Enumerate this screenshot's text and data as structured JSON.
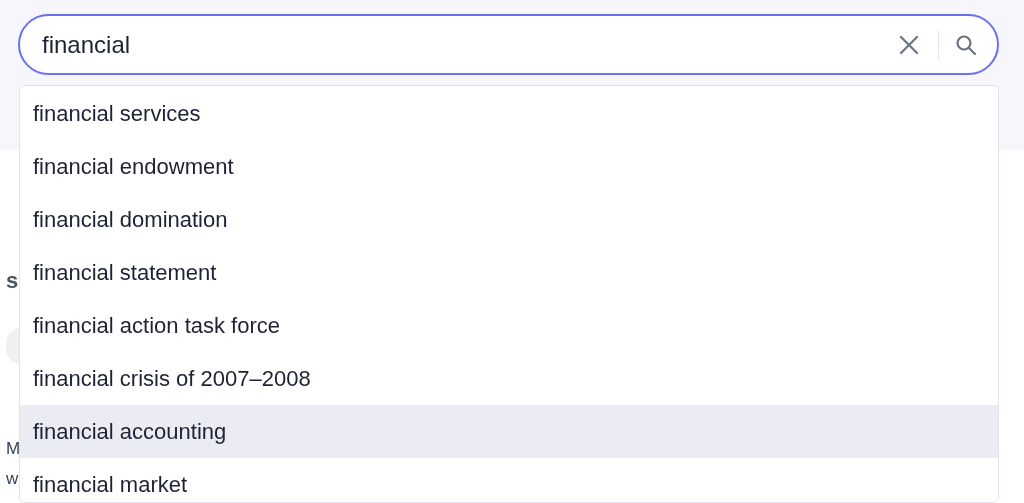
{
  "search": {
    "value": "financial"
  },
  "background_fragments": [
    {
      "kind": "heading",
      "text": "s"
    },
    {
      "kind": "chip"
    },
    {
      "kind": "body",
      "text": "M"
    },
    {
      "kind": "body",
      "text": "w"
    }
  ],
  "suggestions": [
    {
      "text": "financial services",
      "selected": false
    },
    {
      "text": "financial endowment",
      "selected": false
    },
    {
      "text": "financial domination",
      "selected": false
    },
    {
      "text": "financial statement",
      "selected": false
    },
    {
      "text": "financial action task force",
      "selected": false
    },
    {
      "text": "financial crisis of 2007–2008",
      "selected": false
    },
    {
      "text": "financial accounting",
      "selected": true
    },
    {
      "text": "financial market",
      "selected": false
    }
  ]
}
